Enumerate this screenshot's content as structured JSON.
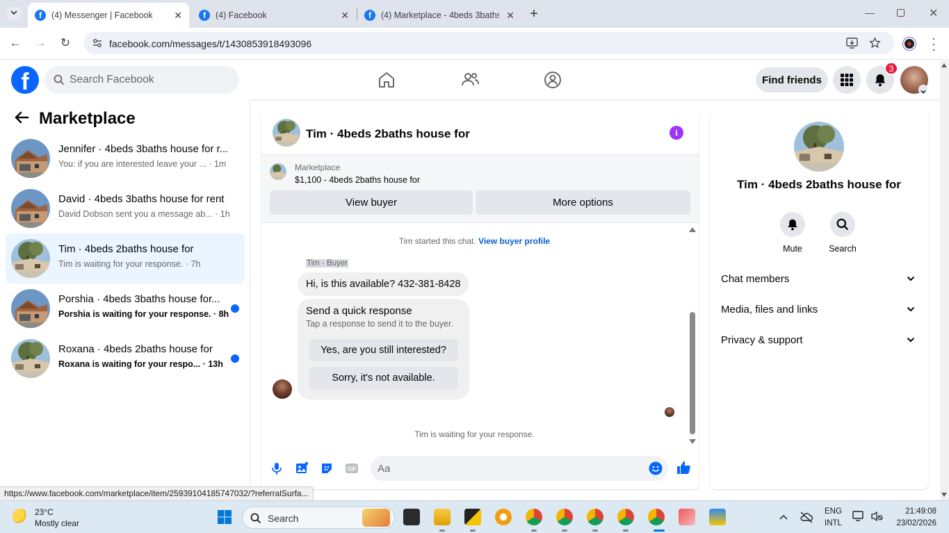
{
  "browser": {
    "tabs": [
      {
        "title": "(4) Messenger | Facebook",
        "active": true
      },
      {
        "title": "(4) Facebook",
        "active": false
      },
      {
        "title": "(4) Marketplace - 4beds 3baths",
        "active": false
      }
    ],
    "url": "facebook.com/messages/t/1430853918493096",
    "status_link": "https://www.facebook.com/marketplace/item/25939104185747032/?referralSurfa..."
  },
  "fb_header": {
    "search_placeholder": "Search Facebook",
    "find_friends_label": "Find friends",
    "notification_count": "3"
  },
  "left_panel": {
    "title": "Marketplace",
    "conversations": [
      {
        "title": "Jennifer · 4beds 3baths house for r...",
        "subtitle": "You: if you are interested leave your ... · 1m",
        "unread": false,
        "selected": false
      },
      {
        "title": "David · 4beds 3baths house for rent",
        "subtitle": "David Dobson sent you a message ab... · 1h",
        "unread": false,
        "selected": false
      },
      {
        "title": "Tim · 4beds 2baths house for",
        "subtitle": "Tim is waiting for your response. · 7h",
        "unread": false,
        "selected": true
      },
      {
        "title": "Porshia · 4beds 3baths house for...",
        "subtitle": "Porshia is waiting for your response. · 8h",
        "unread": true,
        "selected": false
      },
      {
        "title": "Roxana · 4beds 2baths house for",
        "subtitle": "Roxana is waiting for your respo... · 13h",
        "unread": true,
        "selected": false
      }
    ]
  },
  "chat": {
    "title": "Tim · 4beds 2baths house for",
    "marketplace_label": "Marketplace",
    "listing": "$1,100 - 4beds 2baths house for",
    "view_buyer_label": "View buyer",
    "more_options_label": "More options",
    "system_message": "Tim started this chat.",
    "system_link": "View buyer profile",
    "sender_label": "Tim · Buyer",
    "message": "Hi, is this available? 432-381-8428",
    "quick_title": "Send a quick response",
    "quick_subtitle": "Tap a response to send it to the buyer.",
    "quick_options": [
      "Yes, are you still interested?",
      "Sorry, it's not available."
    ],
    "waiting_text": "Tim is waiting for your response.",
    "input_placeholder": "Aa"
  },
  "right_panel": {
    "name": "Tim · 4beds 2baths house for",
    "mute_label": "Mute",
    "search_label": "Search",
    "sections": [
      "Chat members",
      "Media, files and links",
      "Privacy & support"
    ]
  },
  "taskbar": {
    "temperature": "23°C",
    "weather": "Mostly clear",
    "search_label": "Search",
    "lang1": "ENG",
    "lang2": "INTL",
    "time": "21:49:08",
    "date": "23/02/2026"
  },
  "colors": {
    "brand": "#0866ff",
    "selected_bg": "#ebf5ff",
    "unread_dot": "#0866ff",
    "info_icon": "#a033ff",
    "badge": "#e41e3f"
  }
}
